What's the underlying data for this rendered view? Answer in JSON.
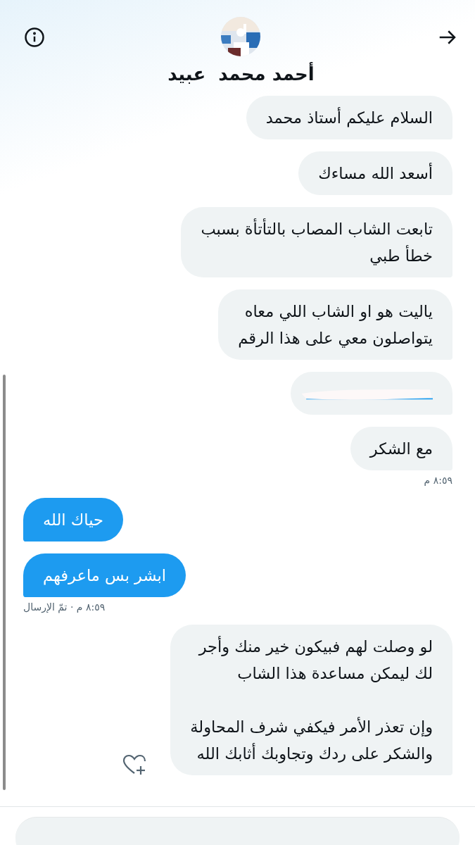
{
  "header": {
    "name": "أحمد محمد  عبيد"
  },
  "messages": [
    {
      "kind": "incoming",
      "text": "السلام عليكم أستاذ محمد"
    },
    {
      "kind": "incoming",
      "text": "أسعد الله مساءك"
    },
    {
      "kind": "incoming",
      "text": "تابعت الشاب المصاب بالتأتأة بسبب\nخطأ طبي"
    },
    {
      "kind": "incoming",
      "text": "ياليت هو او الشاب اللي معاه\nيتواصلون معي على هذا الرقم"
    },
    {
      "kind": "redacted"
    },
    {
      "kind": "incoming",
      "text": "مع الشكر",
      "time": "٨:٥٩ م"
    },
    {
      "kind": "outgoing",
      "text": "حياك الله"
    },
    {
      "kind": "outgoing",
      "text": "ابشر بس ماعرفهم",
      "time": "٨:٥٩ م · تمّ الإرسال"
    },
    {
      "kind": "incoming",
      "text": "لو وصلت لهم فبيكون خير منك وأجر\nلك ليمكن مساعدة هذا الشاب\n\nوإن تعذر الأمر فيكفي شرف المحاولة\nوالشكر على ردك وتجاوبك أثابك الله",
      "react": true
    }
  ]
}
